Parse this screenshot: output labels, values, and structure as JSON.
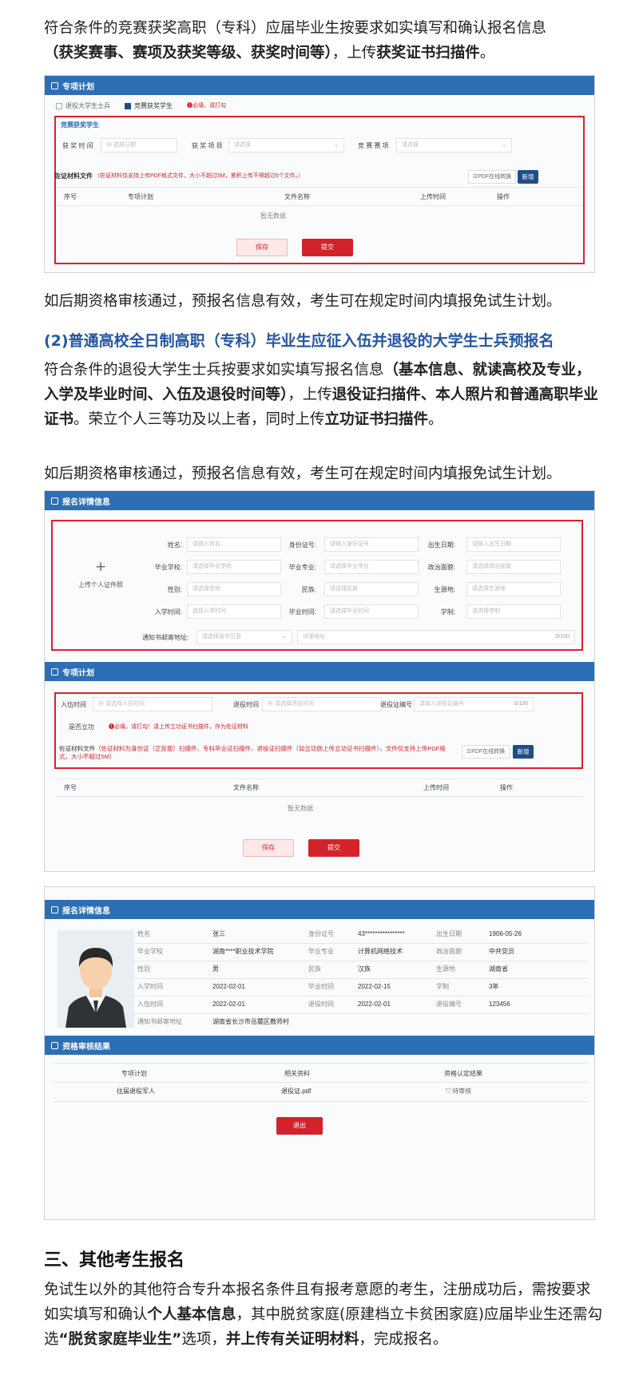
{
  "intro": {
    "line1": "符合条件的竞赛获奖高职（专科）应届毕业生按要求如实填写和确认报名信息",
    "line2_bold": "（获奖赛事、赛项及获奖等级、获奖时间等）",
    "line2_mid": "，上传",
    "line2_bold2": "获奖证书扫描件",
    "line2_end": "。"
  },
  "shot1": {
    "bar_title": "专项计划",
    "check1": "退役大学生士兵",
    "check2": "竞赛获奖学生",
    "hint": "❶必填，请打勾",
    "section": "竞赛获奖学生",
    "lbl_time": "获 奖 时 间",
    "ph_time": "选择日期",
    "lbl_item": "获 奖 项 目",
    "ph_item": "请选择",
    "lbl_race": "竞 赛 赛 项",
    "ph_race": "请选择",
    "file_label": "佐证材料文件",
    "file_note": "（佐证材料仅支持上传PDF格式文件，大小不超过5M，累积上传不得超过6个文件。）",
    "btn_pdf": "☰PDF在线转换",
    "btn_new": "新增",
    "cols": [
      "序号",
      "专项计划",
      "文件名称",
      "上传时间",
      "操作"
    ],
    "empty": "暂无数据",
    "save": "保存",
    "submit": "提交"
  },
  "after1": "如后期资格审核通过，预报名信息有效，考生可在规定时间内填报免试生计划。",
  "heading2": "(2)普通高校全日制高职（专科）毕业生应征入伍并退役的大学生士兵预报名",
  "para2": {
    "t1": "符合条件的退役大学生士兵按要求如实填写报名信息",
    "b1": "（基本信息、就读高校及专业，入学及毕业时间、入伍及退役时间等）",
    "t2": "，上传",
    "b2": "退役证扫描件、本人照片和普通高职毕业证书",
    "t3": "。荣立个人三等功及以上者，同时上传",
    "b3": "立功证书扫描件",
    "t4": "。"
  },
  "after2": "如后期资格审核通过，预报名信息有效，考生可在规定时间内填报免试生计划。",
  "shot2": {
    "bar_title": "报名详情信息",
    "upload_plus": "+",
    "upload_label": "上传个人证件照",
    "rows": [
      [
        {
          "k": "姓名:",
          "v": "请输入姓名"
        },
        {
          "k": "身份证号:",
          "v": "请输入身份证号"
        },
        {
          "k": "出生日期:",
          "v": "请输入出生日期"
        }
      ],
      [
        {
          "k": "毕业学校:",
          "v": "请选择毕业学校"
        },
        {
          "k": "毕业专业:",
          "v": "请选择毕业专业"
        },
        {
          "k": "政治面貌:",
          "v": "请选择政治面貌"
        }
      ],
      [
        {
          "k": "性别:",
          "v": "请选择性别"
        },
        {
          "k": "民族:",
          "v": "请选择民族"
        },
        {
          "k": "生源地:",
          "v": "请选择生源地"
        }
      ],
      [
        {
          "k": "入学时间:",
          "v": "选择入学时间"
        },
        {
          "k": "毕业时间:",
          "v": "请选择毕业时间"
        },
        {
          "k": "学制:",
          "v": "请选择学制"
        }
      ]
    ],
    "addr_label": "通知书邮寄地址:",
    "addr_ph": "请选择省市区县",
    "addr_detail": "详细地址",
    "addr_count": "0/100",
    "bar2_title": "专项计划",
    "enlist_label": "入伍时间",
    "enlist_ph": "请选择入伍时间",
    "retire_label": "退役时间",
    "retire_ph": "请选择退役时间",
    "cert_label": "退役证编号",
    "cert_ph": "请输入退役证编号",
    "cert_count": "0/100",
    "merit_label": "是否立功",
    "merit_hint": "❶必填，请打勾！请上传立功证书扫描件，作为佐证材料",
    "file_label": "佐证材料文件",
    "file_note": "（佐证材料为身份证（正反面）扫描件、专科毕业证扫描件、退役证扫描件（如立功则上传立功证书扫描件），文件仅支持上传PDF格式，大小不超过5M）",
    "btn_pdf": "☰PDF在线转换",
    "btn_new": "新增",
    "cols": [
      "序号",
      "文件名称",
      "上传时间",
      "操作"
    ],
    "empty": "暂无数据",
    "save": "保存",
    "submit": "提交"
  },
  "shot3": {
    "bar_title": "报名详情信息",
    "rows": [
      [
        {
          "k": "姓名",
          "v": "张三"
        },
        {
          "k": "身份证号",
          "v": "43****************"
        },
        {
          "k": "出生日期",
          "v": "1906-05-26"
        }
      ],
      [
        {
          "k": "毕业学校",
          "v": "湖南****职业技术学院"
        },
        {
          "k": "毕业专业",
          "v": "计算机网络技术"
        },
        {
          "k": "政治面貌",
          "v": "中共党员"
        }
      ],
      [
        {
          "k": "性别",
          "v": "男"
        },
        {
          "k": "民族",
          "v": "汉族"
        },
        {
          "k": "生源地",
          "v": "湖南省"
        }
      ],
      [
        {
          "k": "入学时间",
          "v": "2022-02-01"
        },
        {
          "k": "毕业时间",
          "v": "2022-02-15"
        },
        {
          "k": "学制",
          "v": "3年"
        }
      ],
      [
        {
          "k": "入伍时间",
          "v": "2022-02-01"
        },
        {
          "k": "退役时间",
          "v": "2022-02-01"
        },
        {
          "k": "退役编号",
          "v": "123456"
        }
      ]
    ],
    "addr_k": "通知书邮寄地址",
    "addr_v": "湖南省长沙市岳麓区教师村",
    "bar2_title": "资格审核结果",
    "cols": [
      "专项计划",
      "相关资料",
      "资格认定结果"
    ],
    "row": [
      "往届退役军人",
      "退役证.pdf",
      "待审核"
    ],
    "exit": "退出"
  },
  "heading3": "三、其他考生报名",
  "para3": {
    "t1": "免试生以外的其他符合专升本报名条件且有报考意愿的考生，注册成功后，需按要求如实填写和确认",
    "b1": "个人基本信息",
    "t2": "，其中脱贫家庭(原建档立卡贫困家庭)应届毕业生还需勾选",
    "b2": "“脱贫家庭毕业生”",
    "t3": "选项，",
    "b3": "并上传有关证明材料",
    "t4": "，完成报名。"
  }
}
